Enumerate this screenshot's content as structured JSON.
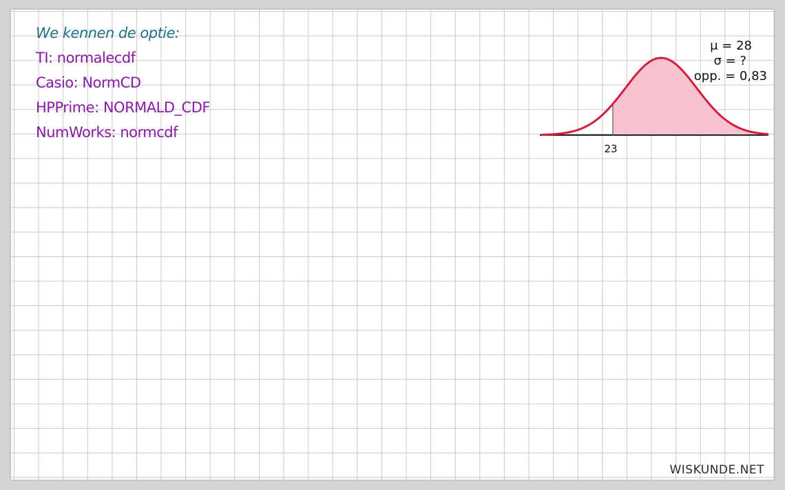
{
  "notes": {
    "title": "We kennen de optie:",
    "ti": "TI: normalecdf",
    "casio": "Casio: NormCD",
    "hp": "HPPrime: NORMALD_CDF",
    "numworks": "NumWorks: normcdf"
  },
  "params": {
    "mu": "μ = 28",
    "sigma": "σ = ?",
    "area": "opp. = 0,83"
  },
  "graph": {
    "boundary_label": "23",
    "curve_color": "#d21e3c",
    "shade_color": "#f6c2cf"
  },
  "brand": "WISKUNDE.NET"
}
